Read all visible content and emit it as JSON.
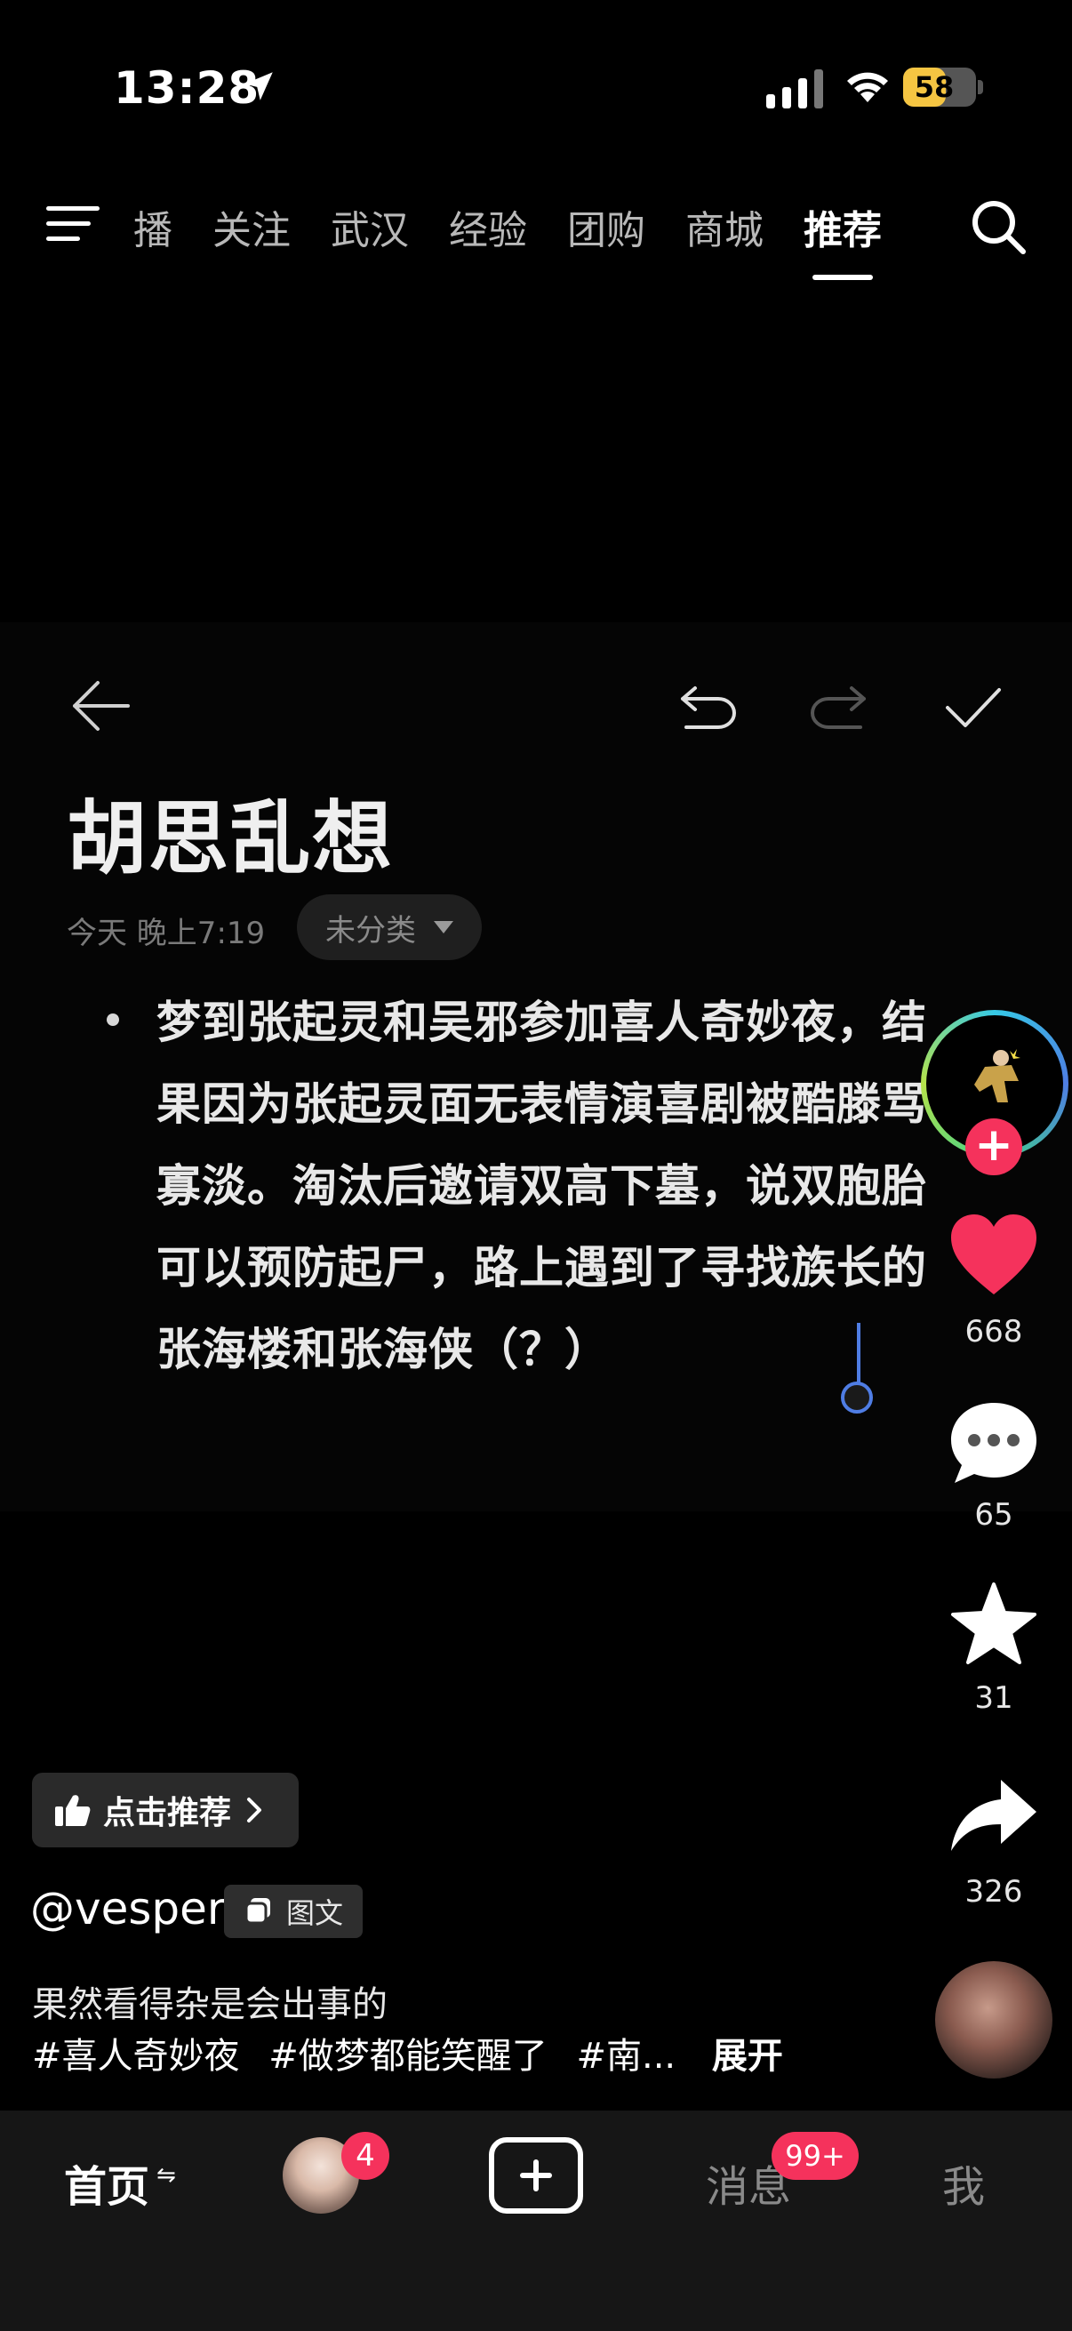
{
  "status_bar": {
    "time": "13:28",
    "battery": "58",
    "battery_level": 0.58
  },
  "top_nav": {
    "items": [
      {
        "label": "播"
      },
      {
        "label": "关注"
      },
      {
        "label": "武汉"
      },
      {
        "label": "经验"
      },
      {
        "label": "团购"
      },
      {
        "label": "商城"
      },
      {
        "label": "推荐",
        "active": true
      }
    ]
  },
  "note": {
    "title": "胡思乱想",
    "timestamp": "今天 晚上7:19",
    "category": "未分类",
    "body": "梦到张起灵和吴邪参加喜人奇妙夜，结果因为张起灵面无表情演喜剧被酷滕骂寡淡。淘汰后邀请双高下墓，说双胞胎可以预防起尸，路上遇到了寻找族长的张海楼和张海侠（？）"
  },
  "actions": {
    "likes": "668",
    "comments": "65",
    "favorites": "31",
    "shares": "326",
    "follow_symbol": "+"
  },
  "post": {
    "recommend_label": "点击推荐",
    "author": "@vesper",
    "type_badge": "图文",
    "caption": "果然看得杂是会出事的",
    "tags": [
      "#喜人奇妙夜",
      "#做梦都能笑醒了",
      "#南..."
    ],
    "expand_label": "展开"
  },
  "tab_bar": {
    "home": "首页",
    "home_arrow": "⇋",
    "friend_badge": "4",
    "messages": "消息",
    "messages_badge": "99+",
    "me": "我"
  },
  "colors": {
    "accent_red": "#f5325c",
    "cursor_blue": "#4f7de4",
    "battery_yellow": "#f5c542"
  }
}
